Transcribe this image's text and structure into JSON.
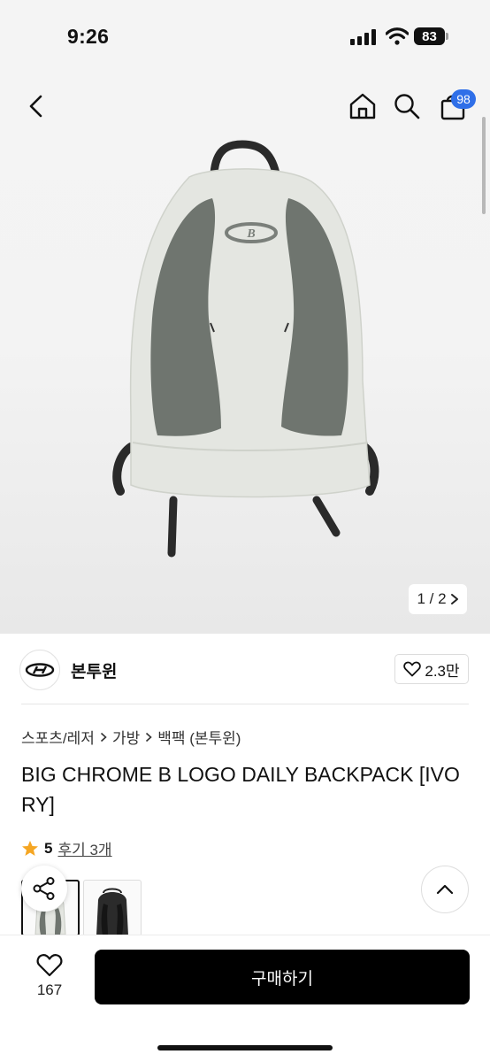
{
  "status_bar": {
    "time": "9:26",
    "battery": "83"
  },
  "header": {
    "cart_badge": "98"
  },
  "gallery": {
    "counter": "1 / 2",
    "colors": {
      "body": "#e4e6e1",
      "panel": "#6f756f",
      "strap": "#2a2a2a"
    }
  },
  "brand": {
    "name": "본투윈",
    "likes": "2.3만"
  },
  "breadcrumb": [
    "스포츠/레저",
    "가방",
    "백팩 (본투윈)"
  ],
  "product": {
    "title": "BIG CHROME B LOGO DAILY BACKPACK [IVORY]",
    "rating": "5",
    "review_link": "후기 3개"
  },
  "bottom_bar": {
    "wish_count": "167",
    "buy_label": "구매하기"
  },
  "icons": [
    "back-icon",
    "home-icon",
    "search-icon",
    "shopping-bag-icon",
    "chevron-right-icon",
    "heart-icon",
    "star-icon",
    "share-icon",
    "chevron-up-icon"
  ],
  "colors": {
    "accent_badge": "#2f6fe8",
    "star": "#f5a623",
    "button": "#000000"
  }
}
